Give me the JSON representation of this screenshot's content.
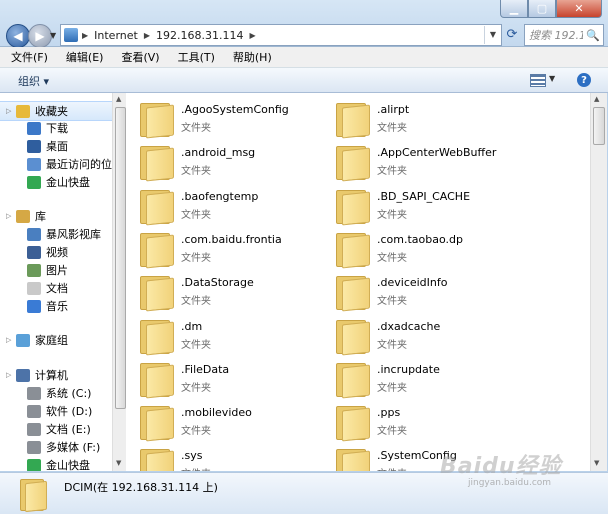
{
  "address": {
    "segments": [
      "Internet",
      "192.168.31.114"
    ],
    "search_placeholder": "搜索 192.1..."
  },
  "menu": [
    "文件(F)",
    "编辑(E)",
    "查看(V)",
    "工具(T)",
    "帮助(H)"
  ],
  "toolbar": {
    "organize_label": "组织 ▾"
  },
  "nav": {
    "items": [
      {
        "label": "收藏夹",
        "icon": "star-icon",
        "color": "#e7b93a",
        "selected": true,
        "level": 0
      },
      {
        "label": "下载",
        "icon": "download-icon",
        "color": "#3c78c8",
        "level": 1
      },
      {
        "label": "桌面",
        "icon": "desktop-icon",
        "color": "#2f5e9e",
        "level": 1
      },
      {
        "label": "最近访问的位置",
        "icon": "recent-icon",
        "color": "#5b8fd1",
        "level": 1
      },
      {
        "label": "金山快盘",
        "icon": "kuaipan-icon",
        "color": "#33a852",
        "level": 1
      },
      {
        "label": "库",
        "icon": "library-icon",
        "color": "#d5a845",
        "level": 0
      },
      {
        "label": "暴风影视库",
        "icon": "video-library-icon",
        "color": "#4a7fc0",
        "level": 1
      },
      {
        "label": "视频",
        "icon": "video-icon",
        "color": "#3c5f95",
        "level": 1
      },
      {
        "label": "图片",
        "icon": "pictures-icon",
        "color": "#6b9a5a",
        "level": 1
      },
      {
        "label": "文档",
        "icon": "documents-icon",
        "color": "#c9c9c9",
        "level": 1
      },
      {
        "label": "音乐",
        "icon": "music-icon",
        "color": "#3a7bd5",
        "level": 1
      },
      {
        "label": "家庭组",
        "icon": "homegroup-icon",
        "color": "#5aa0d8",
        "level": 0
      },
      {
        "label": "计算机",
        "icon": "computer-icon",
        "color": "#4d73a8",
        "level": 0
      },
      {
        "label": "系统 (C:)",
        "icon": "drive-c-icon",
        "color": "#8a8f96",
        "level": 1
      },
      {
        "label": "软件 (D:)",
        "icon": "drive-d-icon",
        "color": "#8a8f96",
        "level": 1
      },
      {
        "label": "文档 (E:)",
        "icon": "drive-e-icon",
        "color": "#8a8f96",
        "level": 1
      },
      {
        "label": "多媒体 (F:)",
        "icon": "drive-f-icon",
        "color": "#8a8f96",
        "level": 1
      },
      {
        "label": "金山快盘",
        "icon": "kuaipan-icon",
        "color": "#33a852",
        "level": 1
      }
    ]
  },
  "files": {
    "type_label": "文件夹",
    "items": [
      ".AgooSystemConfig",
      ".alirpt",
      ".android_msg",
      ".AppCenterWebBuffer",
      ".baofengtemp",
      ".BD_SAPI_CACHE",
      ".com.baidu.frontia",
      ".com.taobao.dp",
      ".DataStorage",
      ".deviceidInfo",
      ".dm",
      ".dxadcache",
      ".FileData",
      ".incrupdate",
      ".mobilevideo",
      ".pps",
      ".sys",
      ".SystemConfig"
    ]
  },
  "details": {
    "title": "DCIM(在 192.168.31.114 上)"
  },
  "watermark": {
    "text": "Baidu经验",
    "sub": "jingyan.baidu.com"
  }
}
